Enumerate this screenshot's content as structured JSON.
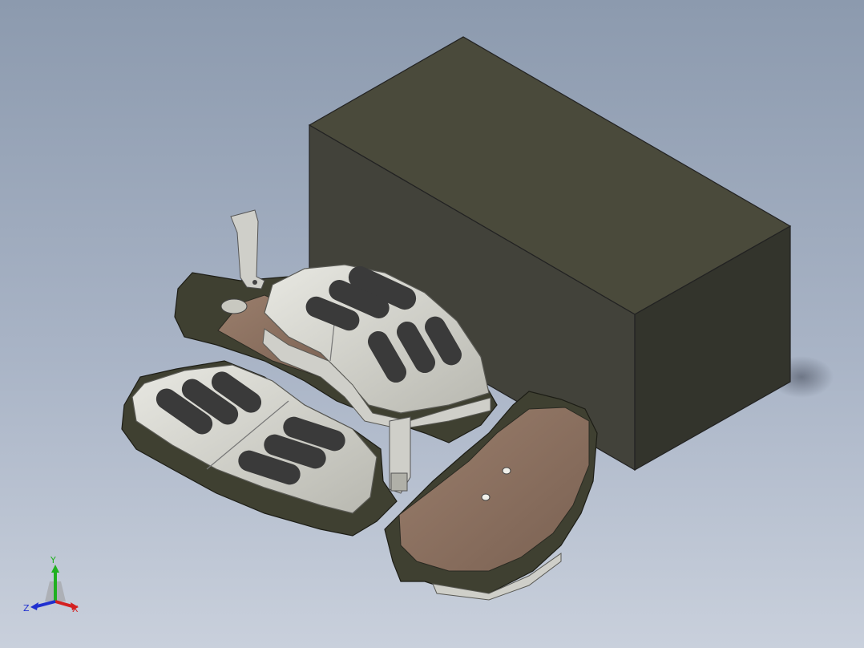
{
  "viewport": {
    "background_top": "#8c9aae",
    "background_bottom": "#c9d0dc"
  },
  "model": {
    "box_color": "#4a4a3b",
    "pad_backing_color": "#3f4031",
    "pad_face_color": "#d8d8d2",
    "friction_material_color": "#8b7060",
    "groove_color": "#3a3a3a"
  },
  "view_triad": {
    "x_label": "X",
    "y_label": "Y",
    "z_label": "Z",
    "x_color": "#d42020",
    "y_color": "#20b020",
    "z_color": "#2030d0"
  }
}
